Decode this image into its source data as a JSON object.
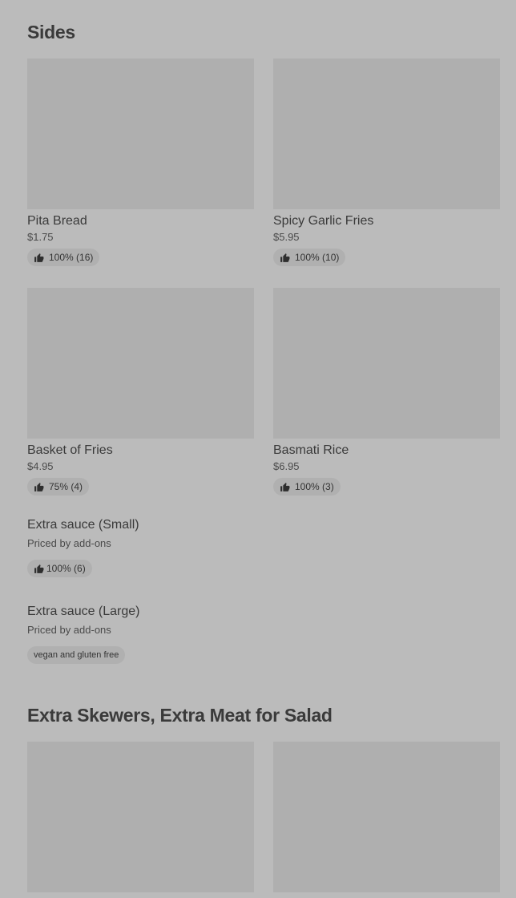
{
  "sections": [
    {
      "title": "Sides",
      "cards": [
        {
          "name": "Pita Bread",
          "price": "$1.75",
          "rating": "100% (16)"
        },
        {
          "name": "Spicy Garlic Fries",
          "price": "$5.95",
          "rating": "100% (10)"
        },
        {
          "name": "Basket of Fries",
          "price": "$4.95",
          "rating": "75% (4)"
        },
        {
          "name": "Basmati Rice",
          "price": "$6.95",
          "rating": "100% (3)"
        }
      ],
      "text_items": [
        {
          "name": "Extra sauce (Small)",
          "description": "Priced by add-ons",
          "rating": "100% (6)"
        },
        {
          "name": "Extra sauce (Large)",
          "description": "Priced by add-ons",
          "tag": "vegan and gluten free"
        }
      ]
    },
    {
      "title": "Extra Skewers, Extra Meat for Salad"
    }
  ],
  "icons": {
    "rating": "thumbs-up-icon"
  },
  "colors": {
    "background": "#bbbbbb",
    "image_placeholder": "#afafaf",
    "pill": "#b0b0b0",
    "text": "#3a3a3a"
  }
}
